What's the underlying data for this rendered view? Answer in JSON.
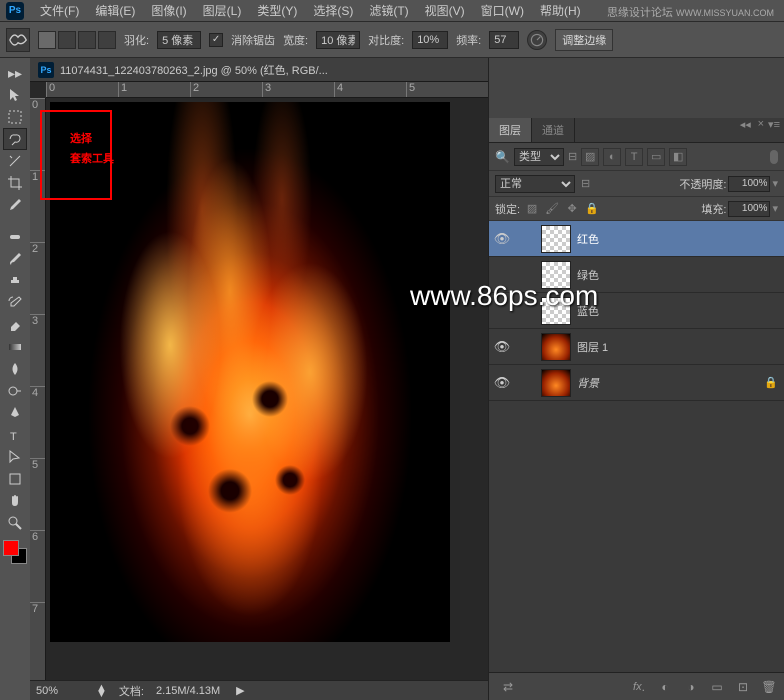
{
  "app": {
    "icon": "Ps"
  },
  "menu": {
    "file": "文件(F)",
    "edit": "编辑(E)",
    "image": "图像(I)",
    "layer": "图层(L)",
    "type": "类型(Y)",
    "select": "选择(S)",
    "filter": "滤镜(T)",
    "view": "视图(V)",
    "window": "窗口(W)",
    "help": "帮助(H)"
  },
  "branding": {
    "text": "思缘设计论坛",
    "url": "WWW.MISSYUAN.COM"
  },
  "options": {
    "feather_label": "羽化:",
    "feather_value": "5 像素",
    "antialias": "消除锯齿",
    "width_label": "宽度:",
    "width_value": "10 像素",
    "contrast_label": "对比度:",
    "contrast_value": "10%",
    "frequency_label": "频率:",
    "frequency_value": "57",
    "refine_edge": "调整边缘"
  },
  "document": {
    "tab_title": "11074431_122403780263_2.jpg @ 50% (红色, RGB/...",
    "ruler_h": [
      "0",
      "1",
      "2",
      "3",
      "4",
      "5"
    ],
    "ruler_v": [
      "0",
      "1",
      "2",
      "3",
      "4",
      "5",
      "6",
      "7"
    ]
  },
  "status": {
    "zoom": "50%",
    "doc_label": "文档:",
    "doc_size": "2.15M/4.13M"
  },
  "annotation": {
    "line1": "选择",
    "line2": "套索工具"
  },
  "watermark": "www.86ps.com",
  "panels": {
    "layers_tab": "图层",
    "channels_tab": "通道",
    "filter_type": "类型",
    "blend_mode": "正常",
    "opacity_label": "不透明度:",
    "opacity_value": "100%",
    "lock_label": "锁定:",
    "fill_label": "填充:",
    "fill_value": "100%",
    "layers": [
      {
        "name": "红色",
        "visible": true,
        "thumb": "checker",
        "selected": true
      },
      {
        "name": "绿色",
        "visible": false,
        "thumb": "checker",
        "selected": false
      },
      {
        "name": "蓝色",
        "visible": false,
        "thumb": "checker",
        "selected": false
      },
      {
        "name": "图层 1",
        "visible": true,
        "thumb": "fire",
        "selected": false
      },
      {
        "name": "背景",
        "visible": true,
        "thumb": "fire",
        "selected": false,
        "locked": true
      }
    ]
  }
}
